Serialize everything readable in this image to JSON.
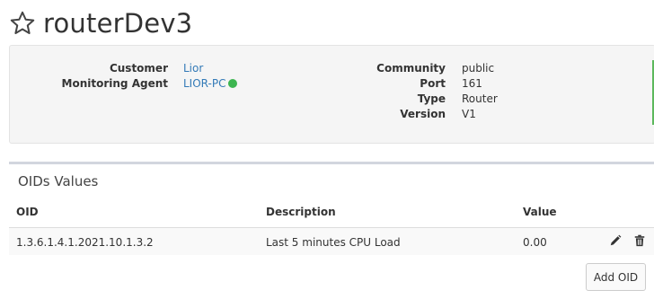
{
  "device": {
    "title": "routerDev3"
  },
  "info": {
    "left": [
      {
        "key": "Customer",
        "value": "Lior"
      },
      {
        "key": "Monitoring Agent",
        "value": "LIOR-PC"
      }
    ],
    "right": [
      {
        "key": "Community",
        "value": "public"
      },
      {
        "key": "Port",
        "value": "161"
      },
      {
        "key": "Type",
        "value": "Router"
      },
      {
        "key": "Version",
        "value": "V1"
      }
    ],
    "agent_status_color": "#3cb550",
    "accent_color": "#5cb85c"
  },
  "oids": {
    "title": "OIDs Values",
    "columns": [
      "OID",
      "Description",
      "Value"
    ],
    "rows": [
      {
        "oid": "1.3.6.1.4.1.2021.10.1.3.2",
        "description": "Last 5 minutes CPU Load",
        "value": "0.00"
      }
    ],
    "add_button": "Add OID"
  }
}
